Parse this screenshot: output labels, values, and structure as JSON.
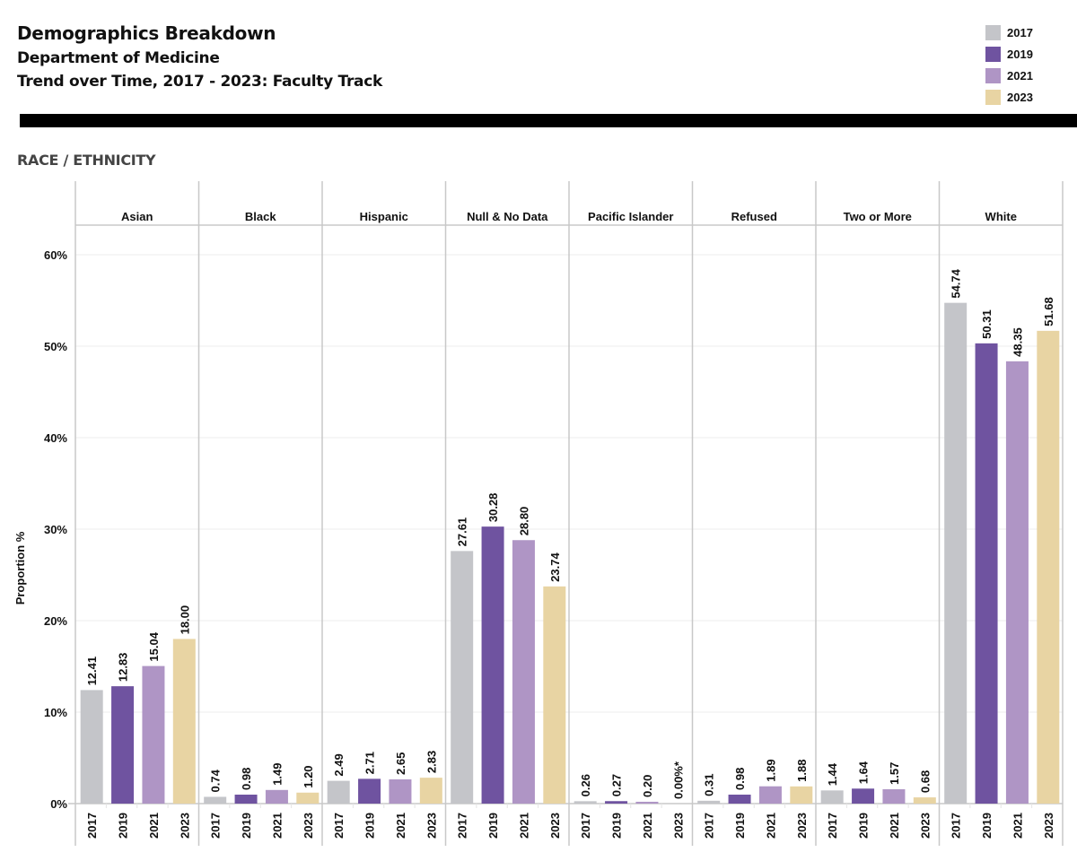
{
  "header": {
    "title": "Demographics Breakdown",
    "subtitle1": "Department of Medicine",
    "subtitle2": "Trend over Time, 2017 - 2023: Faculty Track"
  },
  "section_title": "RACE / ETHNICITY",
  "legend": {
    "items": [
      {
        "label": "2017",
        "color": "#c4c5c9"
      },
      {
        "label": "2019",
        "color": "#6f53a0"
      },
      {
        "label": "2021",
        "color": "#af95c5"
      },
      {
        "label": "2023",
        "color": "#e8d4a3"
      }
    ]
  },
  "chart_data": {
    "type": "bar",
    "title": "RACE / ETHNICITY",
    "xlabel": "",
    "ylabel": "Proportion %",
    "ylim": [
      0,
      60
    ],
    "yticks": [
      "0%",
      "10%",
      "20%",
      "30%",
      "40%",
      "50%",
      "60%"
    ],
    "ytick_values": [
      0,
      10,
      20,
      30,
      40,
      50,
      60
    ],
    "grid": true,
    "legend_position": "top-right",
    "years": [
      "2017",
      "2019",
      "2021",
      "2023"
    ],
    "groups": [
      {
        "name": "Asian",
        "values": [
          12.41,
          12.83,
          15.04,
          18.0
        ],
        "labels": [
          "12.41",
          "12.83",
          "15.04",
          "18.00"
        ]
      },
      {
        "name": "Black",
        "values": [
          0.74,
          0.98,
          1.49,
          1.2
        ],
        "labels": [
          "0.74",
          "0.98",
          "1.49",
          "1.20"
        ]
      },
      {
        "name": "Hispanic",
        "values": [
          2.49,
          2.71,
          2.65,
          2.83
        ],
        "labels": [
          "2.49",
          "2.71",
          "2.65",
          "2.83"
        ]
      },
      {
        "name": "Null & No Data",
        "values": [
          27.61,
          30.28,
          28.8,
          23.74
        ],
        "labels": [
          "27.61",
          "30.28",
          "28.80",
          "23.74"
        ]
      },
      {
        "name": "Pacific Islander",
        "values": [
          0.26,
          0.27,
          0.2,
          0.0
        ],
        "labels": [
          "0.26",
          "0.27",
          "0.20",
          "0.00%*"
        ]
      },
      {
        "name": "Refused",
        "values": [
          0.31,
          0.98,
          1.89,
          1.88
        ],
        "labels": [
          "0.31",
          "0.98",
          "1.89",
          "1.88"
        ]
      },
      {
        "name": "Two or More",
        "values": [
          1.44,
          1.64,
          1.57,
          0.68
        ],
        "labels": [
          "1.44",
          "1.64",
          "1.57",
          "0.68"
        ]
      },
      {
        "name": "White",
        "values": [
          54.74,
          50.31,
          48.35,
          51.68
        ],
        "labels": [
          "54.74",
          "50.31",
          "48.35",
          "51.68"
        ]
      }
    ],
    "series": [
      {
        "name": "2017",
        "values": [
          12.41,
          0.74,
          2.49,
          27.61,
          0.26,
          0.31,
          1.44,
          54.74
        ]
      },
      {
        "name": "2019",
        "values": [
          12.83,
          0.98,
          2.71,
          30.28,
          0.27,
          0.98,
          1.64,
          50.31
        ]
      },
      {
        "name": "2021",
        "values": [
          15.04,
          1.49,
          2.65,
          28.8,
          0.2,
          1.89,
          1.57,
          48.35
        ]
      },
      {
        "name": "2023",
        "values": [
          18.0,
          1.2,
          2.83,
          23.74,
          0.0,
          1.88,
          0.68,
          51.68
        ]
      }
    ],
    "categories": [
      "Asian",
      "Black",
      "Hispanic",
      "Null & No Data",
      "Pacific Islander",
      "Refused",
      "Two or More",
      "White"
    ]
  }
}
